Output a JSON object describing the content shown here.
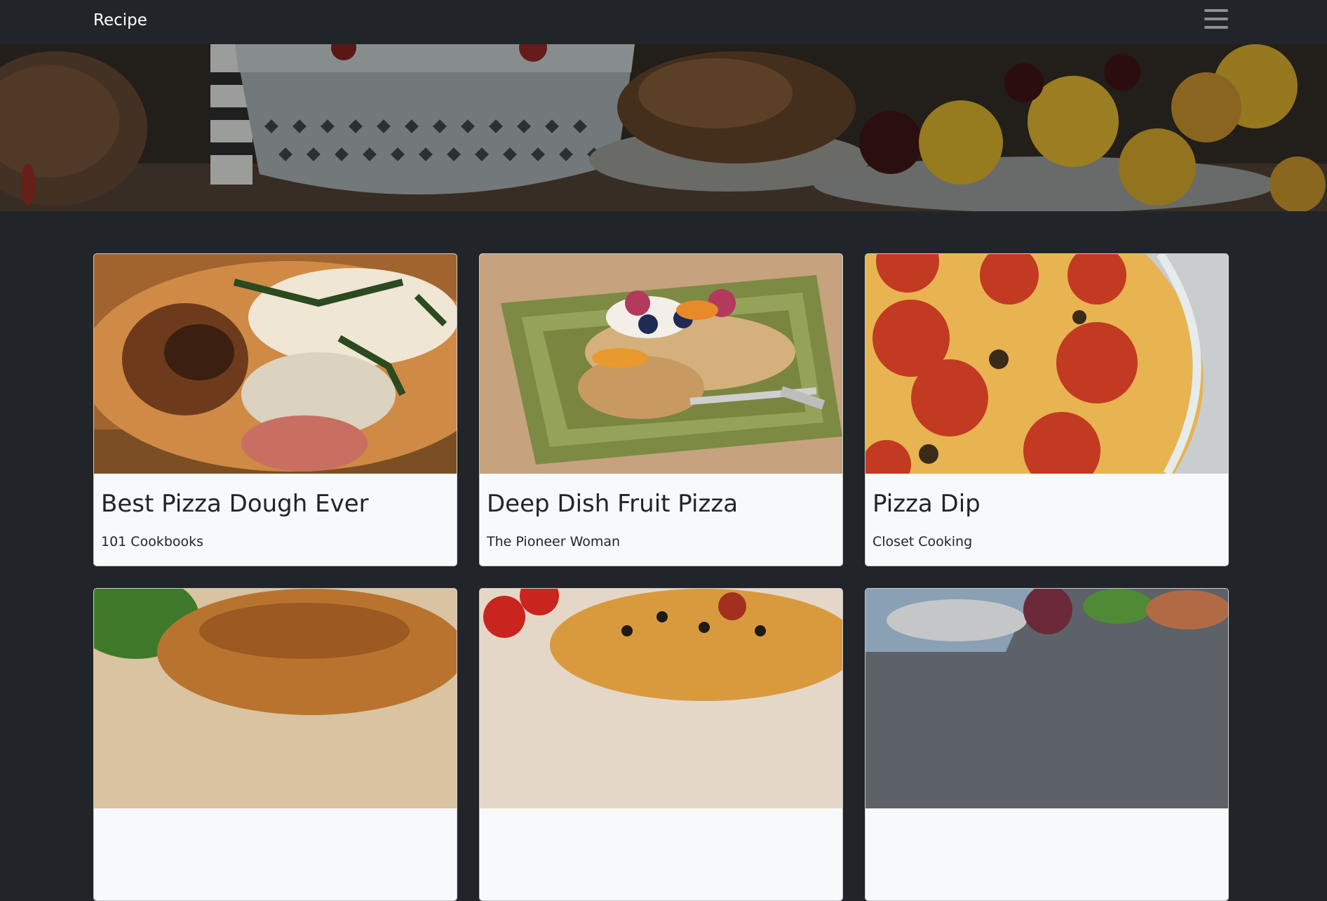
{
  "navbar": {
    "brand": "Recipe",
    "menu_icon": "hamburger-menu-icon"
  },
  "hero": {
    "image": "food-table-banner"
  },
  "recipes": [
    {
      "title": "Best Pizza Dough Ever",
      "source": "101 Cookbooks",
      "image": "pizza-crust-basil-photo"
    },
    {
      "title": "Deep Dish Fruit Pizza",
      "source": "The Pioneer Woman",
      "image": "fruit-pizza-plate-photo"
    },
    {
      "title": "Pizza Dip",
      "source": "Closet Cooking",
      "image": "pepperoni-dip-photo"
    },
    {
      "title": "",
      "source": "",
      "image": "flatbread-pizza-photo"
    },
    {
      "title": "",
      "source": "",
      "image": "pepperoni-olive-pizza-photo"
    },
    {
      "title": "",
      "source": "",
      "image": "table-setting-photo"
    }
  ]
}
